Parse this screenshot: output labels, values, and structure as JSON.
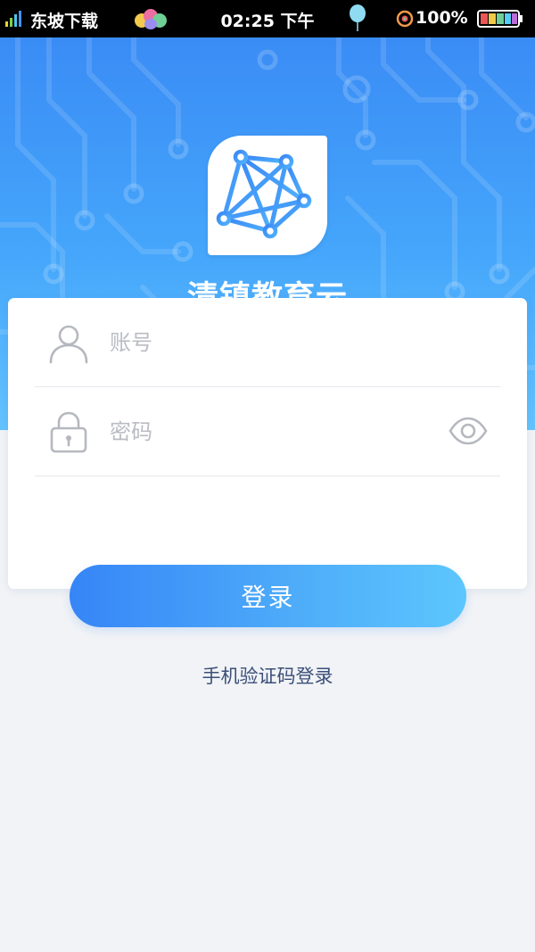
{
  "status_bar": {
    "carrier": "东坡下载",
    "time": "02:25 下午",
    "battery_percent": "100%"
  },
  "header": {
    "app_name": "清镇教育云",
    "logo_icon": "network-nodes-icon"
  },
  "login_form": {
    "account": {
      "placeholder": "账号",
      "value": "",
      "icon": "user-icon"
    },
    "password": {
      "placeholder": "密码",
      "value": "",
      "icon": "lock-icon",
      "toggle_icon": "eye-icon"
    }
  },
  "actions": {
    "login_label": "登录",
    "sms_login_label": "手机验证码登录"
  },
  "colors": {
    "primary": "#3a8cf5",
    "primary_light": "#5cc6fd",
    "background": "#f1f3f6",
    "link": "#3b4f78"
  }
}
